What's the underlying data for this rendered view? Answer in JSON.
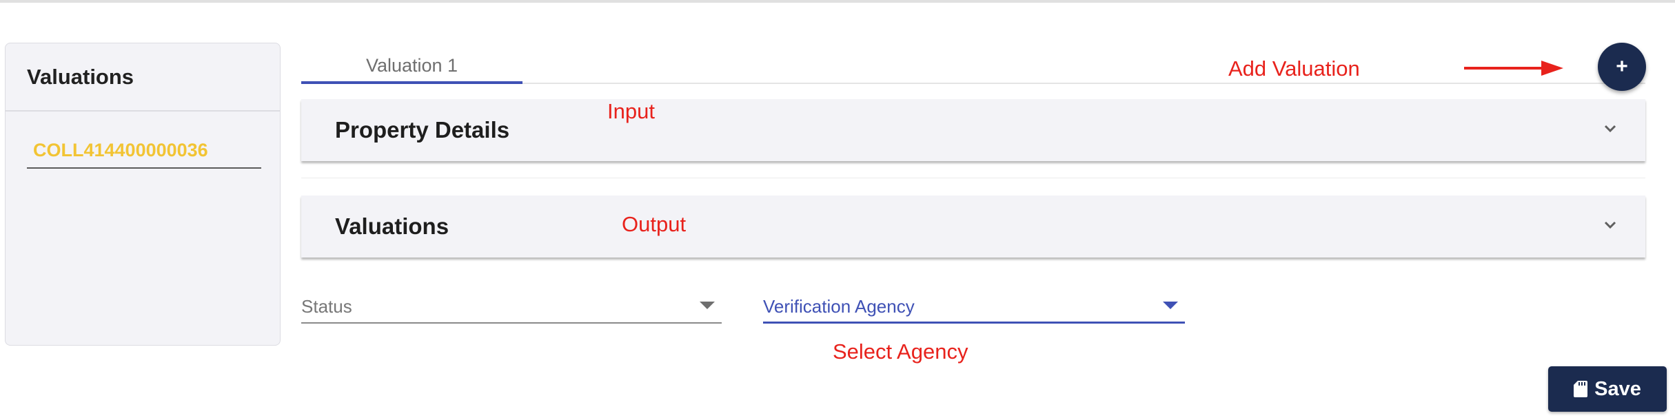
{
  "sidebar": {
    "title": "Valuations",
    "items": [
      {
        "label": "COLL414400000036"
      }
    ]
  },
  "tabs": [
    {
      "label": "Valuation 1",
      "active": true
    }
  ],
  "add_button": {
    "glyph": "+",
    "icon": "plus-icon"
  },
  "panels": [
    {
      "title": "Property Details",
      "icon": "chevron-down-icon"
    },
    {
      "title": "Valuations",
      "icon": "chevron-down-icon"
    }
  ],
  "fields": {
    "status": {
      "placeholder": "Status"
    },
    "verification_agency": {
      "placeholder": "Verification Agency"
    }
  },
  "save_button": {
    "label": "Save",
    "icon": "sd-card-icon"
  },
  "annotations": {
    "add_valuation": "Add Valuation",
    "input": "Input",
    "output": "Output",
    "select_agency": "Select Agency"
  },
  "colors": {
    "accent": "#3f51b5",
    "primary_dark": "#1b2b4f",
    "link_yellow": "#f2c434",
    "annotation_red": "#e8221c",
    "panel_bg": "#f3f3f7"
  }
}
